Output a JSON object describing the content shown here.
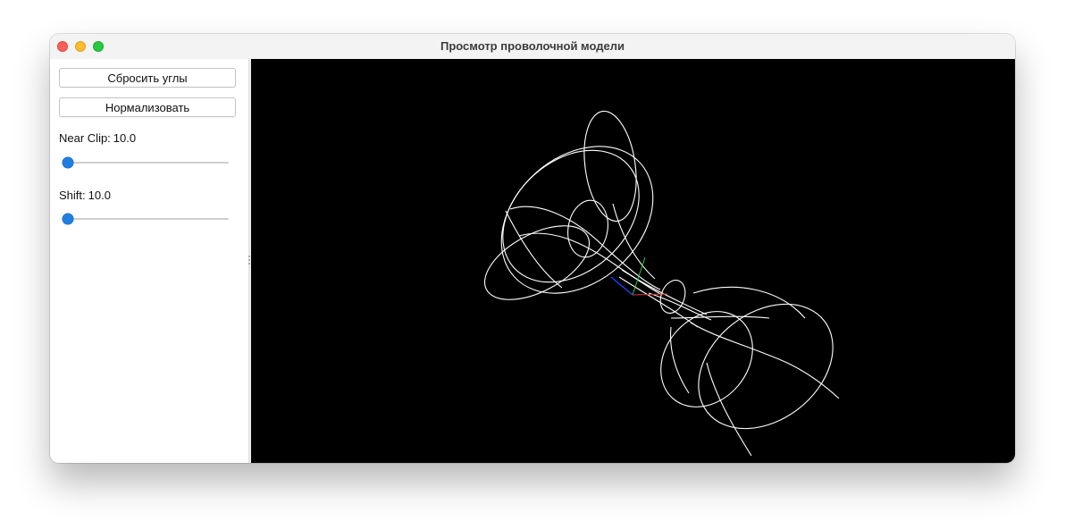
{
  "window": {
    "title": "Просмотр проволочной модели"
  },
  "sidebar": {
    "reset_button": "Сбросить углы",
    "normalize_button": "Нормализовать",
    "near_clip": {
      "label": "Near Clip:",
      "value": "10.0",
      "level": 0.0
    },
    "shift": {
      "label": "Shift:",
      "value": "10.0",
      "level": 0.0
    }
  },
  "viewport": {
    "background": "#000000",
    "wire_color": "#ffffff",
    "axis_colors": {
      "x": "#e03030",
      "y": "#2ecc40",
      "z": "#2040ff"
    }
  },
  "colors": {
    "slider_thumb": "#1f7ee0",
    "traffic_close": "#fe5f57",
    "traffic_min": "#febc2e",
    "traffic_max": "#28c840"
  }
}
